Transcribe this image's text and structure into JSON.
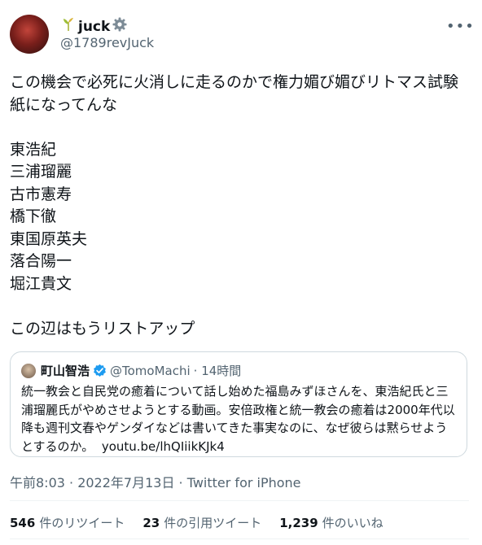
{
  "author": {
    "display_name": "juck",
    "handle": "@1789revJuck"
  },
  "tweet": {
    "text": "この機会で必死に火消しに走るのかで権力媚び媚びリトマス試験紙になってんな\n\n東浩紀\n三浦瑠麗\n古市憲寿\n橋下徹\n東国原英夫\n落合陽一\n堀江貴文\n\nこの辺はもうリストアップ"
  },
  "quote": {
    "author_name": "町山智浩",
    "handle": "@TomoMachi",
    "time": "· 14時間",
    "text": "統一教会と自民党の癒着について話し始めた福島みずほさんを、東浩紀氏と三浦瑠麗氏がやめさせようとする動画。安倍政権と統一教会の癒着は2000年代以降も週刊文春やゲンダイなどは書いてきた事実なのに、なぜ彼らは黙らせようとするのか。",
    "link": "youtu.be/lhQIiikKJk4"
  },
  "meta": {
    "timestamp": "午前8:03 · 2022年7月13日",
    "source": "· Twitter for iPhone"
  },
  "stats": {
    "retweets_count": "546",
    "retweets_label": "件のリツイート",
    "quotes_count": "23",
    "quotes_label": "件の引用ツイート",
    "likes_count": "1,239",
    "likes_label": "件のいいね"
  },
  "icons": {
    "name_prefix": "sprout-icon",
    "name_suffix": "gear-icon",
    "verified": "verified-badge-icon",
    "more": "more-options-icon"
  },
  "colors": {
    "text": "#0f1419",
    "secondary": "#536471",
    "link": "#1d9bf0",
    "border": "#cfd9de"
  }
}
